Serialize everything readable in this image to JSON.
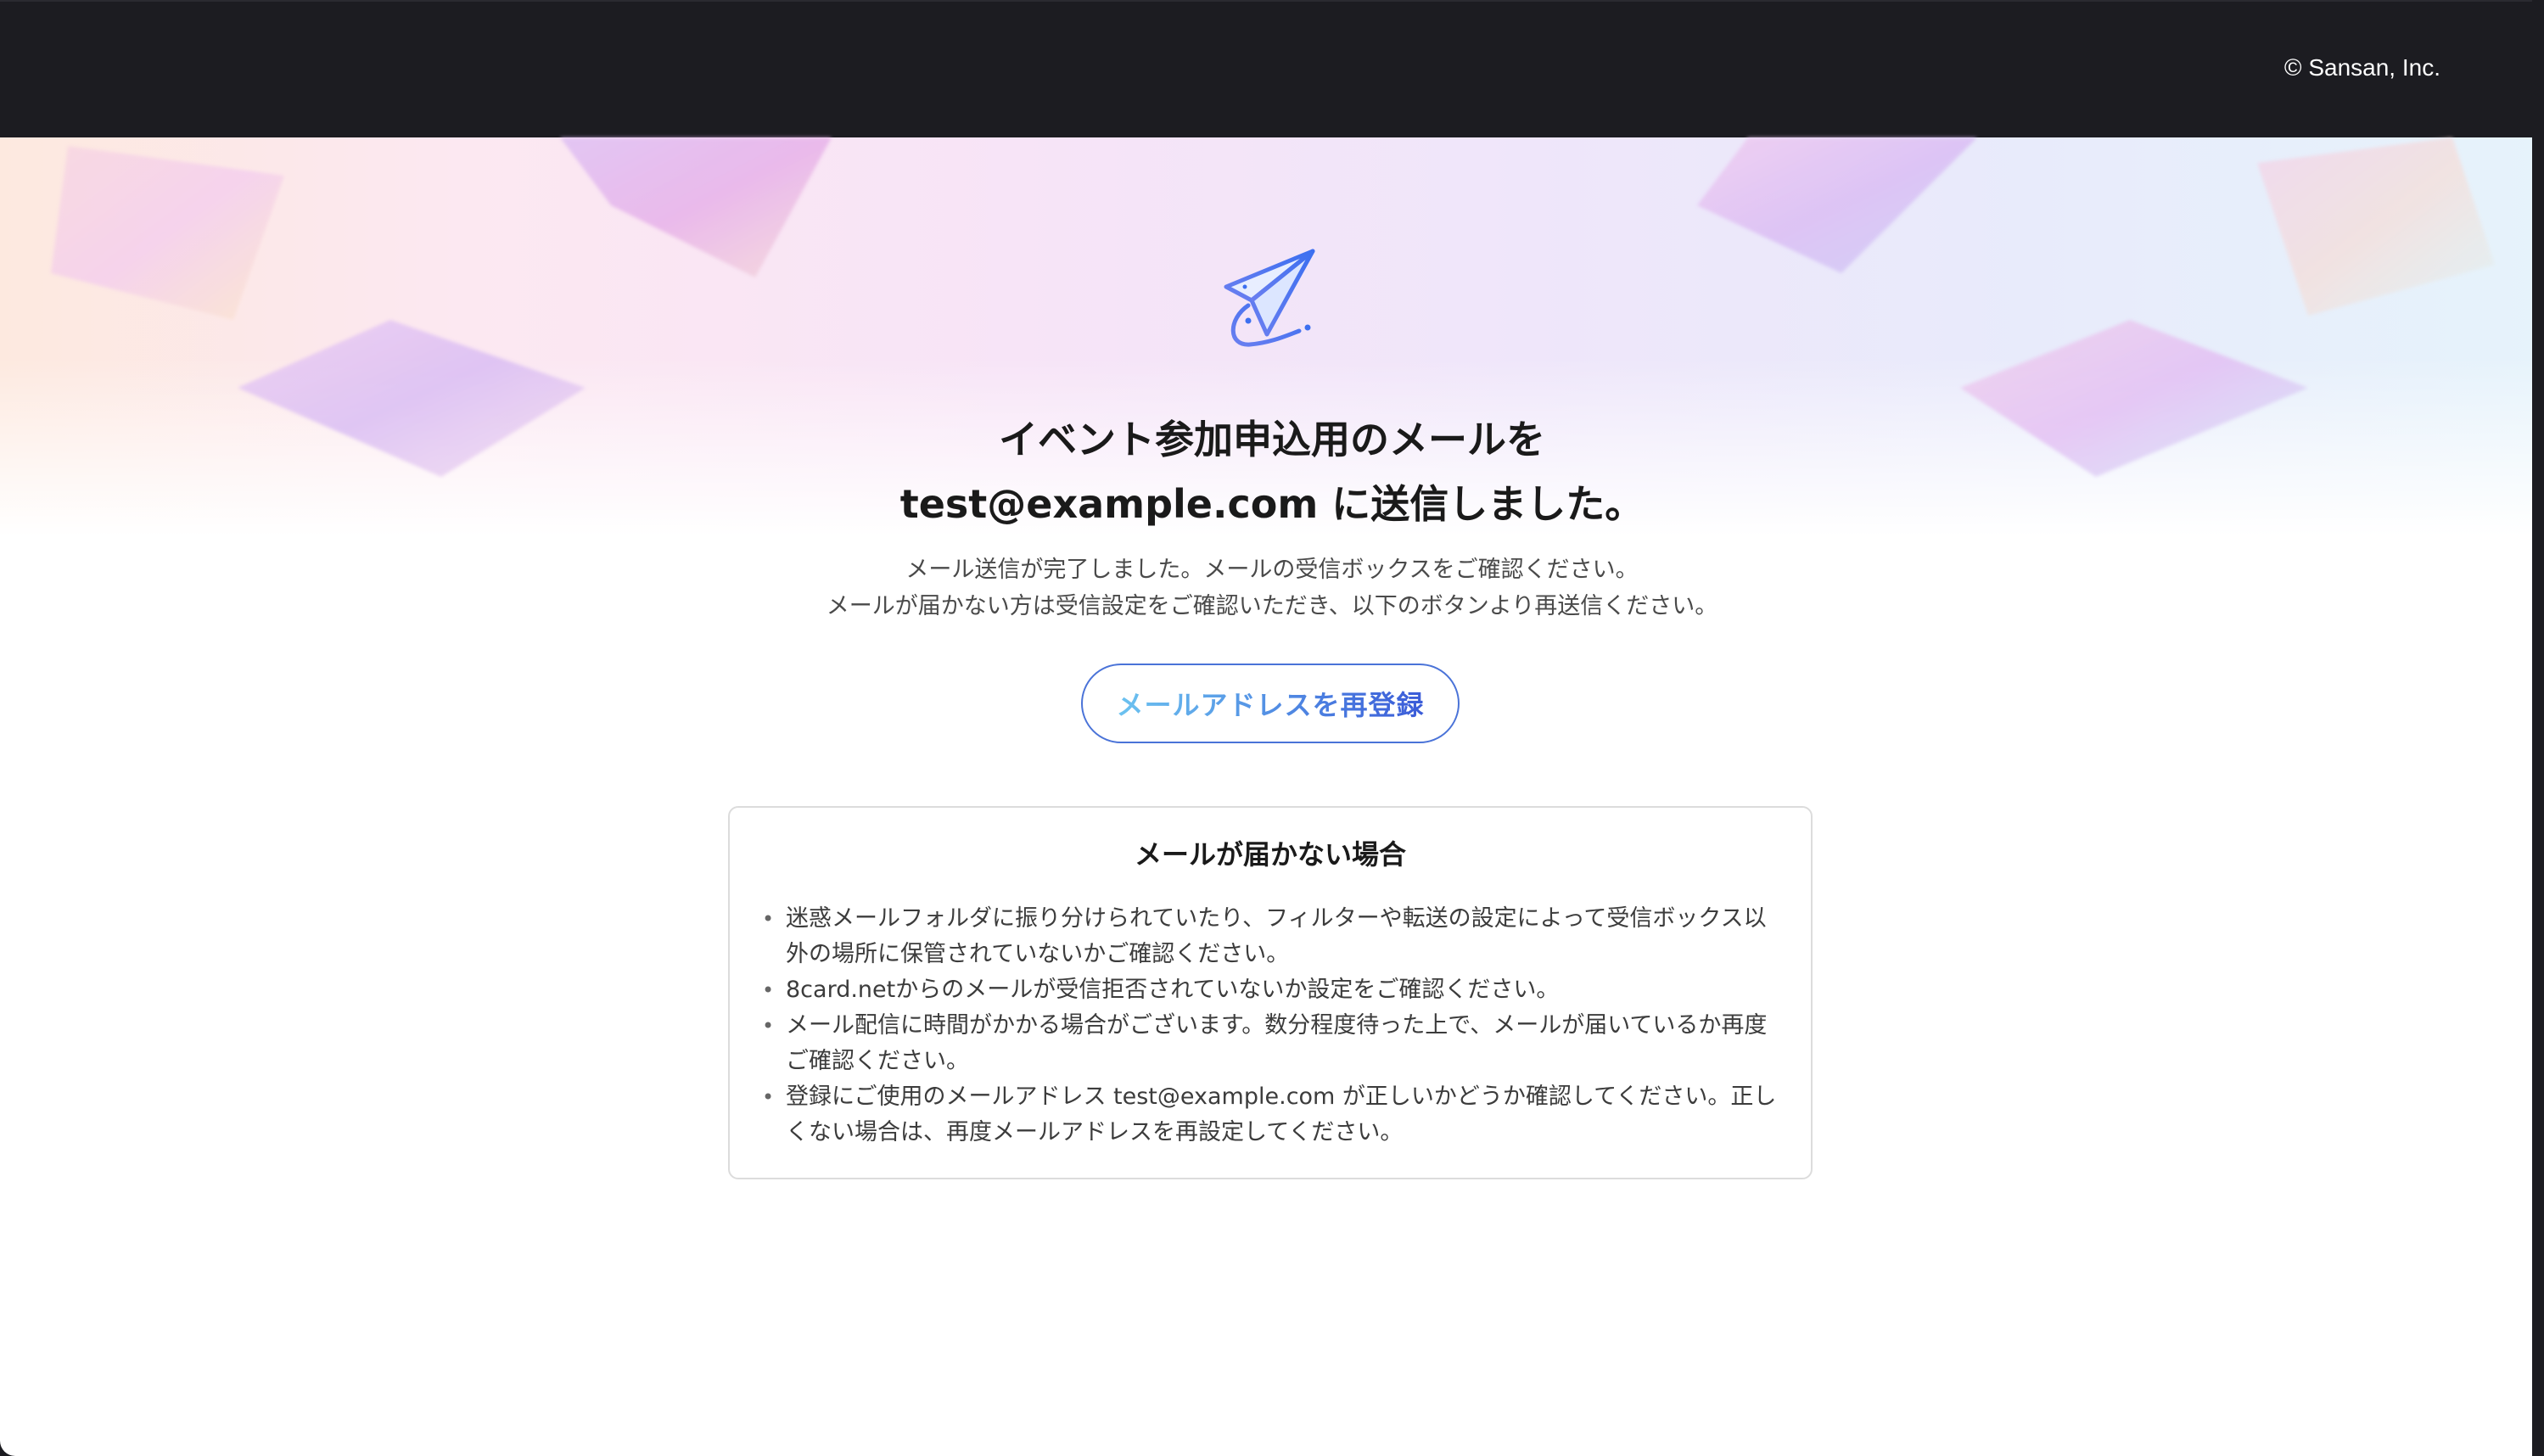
{
  "header": {
    "copyright": "© Sansan, Inc."
  },
  "hero": {
    "icon": "paper-plane-icon",
    "title_line1": "イベント参加申込用のメールを",
    "title_line2": "test@example.com に送信しました。",
    "subtitle_line1": "メール送信が完了しました。メールの受信ボックスをご確認ください。",
    "subtitle_line2": "メールが届かない方は受信設定をご確認いただき、以下のボタンより再送信ください。"
  },
  "actions": {
    "reregister_label": "メールアドレスを再登録"
  },
  "help": {
    "title": "メールが届かない場合",
    "items": [
      "迷惑メールフォルダに振り分けられていたり、フィルターや転送の設定によって受信ボックス以外の場所に保管されていないかご確認ください。",
      "8card.netからのメールが受信拒否されていないか設定をご確認ください。",
      "メール配信に時間がかかる場合がございます。数分程度待った上で、メールが届いているか再度ご確認ください。",
      "登録にご使用のメールアドレス test@example.com が正しいかどうか確認してください。正しくない場合は、再度メールアドレスを再設定してください。"
    ]
  },
  "colors": {
    "topbar": "#1c1c21",
    "button_border": "#4a73d8",
    "button_text_start": "#6cc3f0",
    "button_text_end": "#3a5bd8"
  }
}
